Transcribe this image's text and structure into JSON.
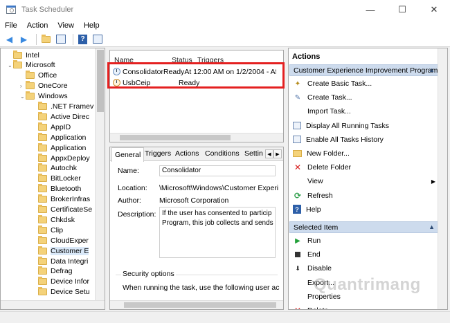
{
  "window": {
    "title": "Task Scheduler",
    "minimize": "—",
    "maximize": "☐",
    "close": "✕"
  },
  "menu": [
    "File",
    "Action",
    "View",
    "Help"
  ],
  "tree": {
    "items": [
      {
        "label": "Intel",
        "indent": 1,
        "chev": ""
      },
      {
        "label": "Microsoft",
        "indent": 1,
        "chev": "⌄"
      },
      {
        "label": "Office",
        "indent": 2,
        "chev": ""
      },
      {
        "label": "OneCore",
        "indent": 2,
        "chev": "›"
      },
      {
        "label": "Windows",
        "indent": 2,
        "chev": "⌄"
      },
      {
        "label": ".NET Framev",
        "indent": 3,
        "chev": ""
      },
      {
        "label": "Active Direc",
        "indent": 3,
        "chev": ""
      },
      {
        "label": "AppID",
        "indent": 3,
        "chev": ""
      },
      {
        "label": "Application",
        "indent": 3,
        "chev": ""
      },
      {
        "label": "Application",
        "indent": 3,
        "chev": ""
      },
      {
        "label": "AppxDeploy",
        "indent": 3,
        "chev": ""
      },
      {
        "label": "Autochk",
        "indent": 3,
        "chev": ""
      },
      {
        "label": "BitLocker",
        "indent": 3,
        "chev": ""
      },
      {
        "label": "Bluetooth",
        "indent": 3,
        "chev": ""
      },
      {
        "label": "BrokerInfras",
        "indent": 3,
        "chev": ""
      },
      {
        "label": "CertificateSe",
        "indent": 3,
        "chev": ""
      },
      {
        "label": "Chkdsk",
        "indent": 3,
        "chev": ""
      },
      {
        "label": "Clip",
        "indent": 3,
        "chev": ""
      },
      {
        "label": "CloudExper",
        "indent": 3,
        "chev": ""
      },
      {
        "label": "Customer E",
        "indent": 3,
        "chev": "",
        "selected": true
      },
      {
        "label": "Data Integri",
        "indent": 3,
        "chev": ""
      },
      {
        "label": "Defrag",
        "indent": 3,
        "chev": ""
      },
      {
        "label": "Device Infor",
        "indent": 3,
        "chev": ""
      },
      {
        "label": "Device Setu",
        "indent": 3,
        "chev": ""
      }
    ]
  },
  "tasklist": {
    "columns": [
      "Name",
      "Status",
      "Triggers"
    ],
    "rows": [
      {
        "name": "Consolidator",
        "status": "Ready",
        "triggers": "At 12:00 AM on 1/2/2004 - Af"
      },
      {
        "name": "UsbCeip",
        "status": "Ready",
        "triggers": ""
      }
    ]
  },
  "details": {
    "tabs": [
      "General",
      "Triggers",
      "Actions",
      "Conditions",
      "Settin"
    ],
    "name_label": "Name:",
    "name_value": "Consolidator",
    "location_label": "Location:",
    "location_value": "\\Microsoft\\Windows\\Customer Experi",
    "author_label": "Author:",
    "author_value": "Microsoft Corporation",
    "description_label": "Description:",
    "description_line1": "If the user has consented to particip",
    "description_line2": "Program, this job collects and sends",
    "security_label": "Security options",
    "security_text": "When running the task, use the following user ac"
  },
  "actions": {
    "title": "Actions",
    "section1": "Customer Experience Improvement Program",
    "items1": [
      {
        "label": "Create Basic Task...",
        "icon": "wand-icon",
        "glyph": "✦",
        "cls": "i-wand"
      },
      {
        "label": "Create Task...",
        "icon": "create-task-icon",
        "glyph": "✎",
        "cls": "i-task"
      },
      {
        "label": "Import Task...",
        "icon": "import-icon",
        "glyph": "",
        "cls": ""
      },
      {
        "label": "Display All Running Tasks",
        "icon": "running-tasks-icon",
        "glyph": "",
        "cls": "i-list"
      },
      {
        "label": "Enable All Tasks History",
        "icon": "history-icon",
        "glyph": "",
        "cls": "i-list"
      },
      {
        "label": "New Folder...",
        "icon": "folder-icon",
        "glyph": "",
        "cls": "i-folder"
      },
      {
        "label": "Delete Folder",
        "icon": "delete-icon",
        "glyph": "✕",
        "cls": "i-x"
      },
      {
        "label": "View",
        "icon": "",
        "glyph": "",
        "cls": "",
        "submenu": true
      },
      {
        "label": "Refresh",
        "icon": "refresh-icon",
        "glyph": "⟳",
        "cls": "i-refresh"
      },
      {
        "label": "Help",
        "icon": "help-icon",
        "glyph": "?",
        "cls": "i-help"
      }
    ],
    "section2": "Selected Item",
    "items2": [
      {
        "label": "Run",
        "icon": "run-icon",
        "glyph": "▶",
        "cls": "i-run"
      },
      {
        "label": "End",
        "icon": "end-icon",
        "glyph": "",
        "cls": "i-end"
      },
      {
        "label": "Disable",
        "icon": "disable-icon",
        "glyph": "⬇",
        "cls": "i-disable"
      },
      {
        "label": "Export...",
        "icon": "export-icon",
        "glyph": "",
        "cls": ""
      },
      {
        "label": "Properties",
        "icon": "properties-icon",
        "glyph": "",
        "cls": ""
      },
      {
        "label": "Delete",
        "icon": "delete-task-icon",
        "glyph": "✕",
        "cls": "i-x"
      }
    ]
  },
  "watermark": "Quantrimang"
}
